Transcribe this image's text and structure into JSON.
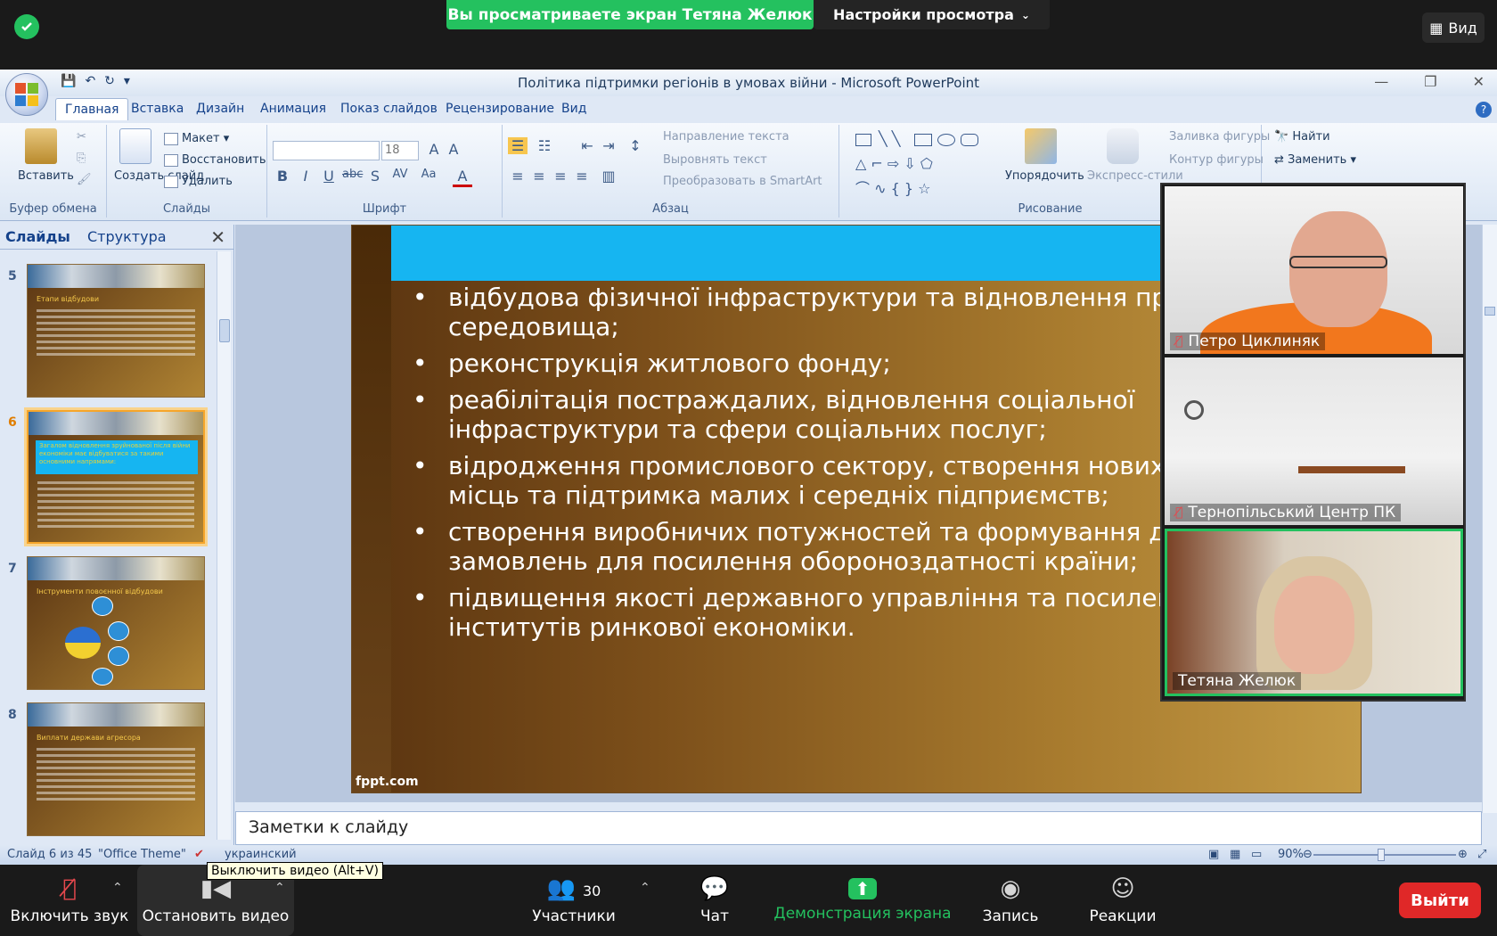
{
  "zoom_top": {
    "viewing_banner": "Вы просматриваете экран Тетяна Желюк",
    "view_settings": "Настройки просмотра",
    "view_button": "Вид"
  },
  "ppt": {
    "window_title": "Політика підтримки регіонів в умовах війни - Microsoft PowerPoint",
    "tabs": [
      "Главная",
      "Вставка",
      "Дизайн",
      "Анимация",
      "Показ слайдов",
      "Рецензирование",
      "Вид"
    ],
    "ribbon": {
      "paste": "Вставить",
      "create_slide": "Создать слайд",
      "layout": "Макет",
      "restore": "Восстановить",
      "delete": "Удалить",
      "font_size": "18",
      "text_direction": "Направление текста",
      "align_text": "Выровнять текст",
      "convert_smartart": "Преобразовать в SmartArt",
      "arrange": "Упорядочить",
      "quick_styles": "Экспресс-стили",
      "shape_fill": "Заливка фигуры",
      "shape_outline": "Контур фигуры",
      "find": "Найти",
      "replace": "Заменить",
      "groups": {
        "clipboard": "Буфер обмена",
        "slides": "Слайды",
        "font": "Шрифт",
        "paragraph": "Абзац",
        "drawing": "Рисование"
      }
    },
    "left_pane": {
      "tab_slides": "Слайды",
      "tab_outline": "Структура",
      "thumbs": [
        {
          "num": "5",
          "title": "Етапи відбудови"
        },
        {
          "num": "6",
          "title": "Загалом відновлення зруйнованої після війни економіки має відбуватися за такими основними напрямами:"
        },
        {
          "num": "7",
          "title": "Інструменти повоєнної відбудови"
        },
        {
          "num": "8",
          "title": "Виплати держави агресора"
        }
      ]
    },
    "slide": {
      "bullets": [
        "відбудова фізичної інфраструктури та відновлення при\nсередовища;",
        "реконструкція житлового фонду;",
        "реабілітація постраждалих, відновлення соціальної\nінфраструктури та сфери соціальних послуг;",
        "відродження промислового сектору, створення нових\nмісць та підтримка малих і середніх підприємств;",
        "створення виробничих потужностей та формування де\nзамовлень для посилення обороноздатності країни;",
        "підвищення якості державного управління та посилен\nінститутів ринкової економіки."
      ],
      "footer": "fppt.com"
    },
    "notes_placeholder": "Заметки к слайду",
    "status": {
      "slide_of": "Слайд 6 из 45",
      "theme": "\"Office Theme\"",
      "language": "украинский",
      "zoom": "90%"
    }
  },
  "videos": [
    {
      "name": "Петро Циклиняк",
      "muted": true
    },
    {
      "name": "Тернопільський Центр ПК",
      "muted": true
    },
    {
      "name": "Тетяна Желюк",
      "muted": false
    }
  ],
  "zoom_bar": {
    "tooltip": "Выключить видео (Alt+V)",
    "unmute": "Включить звук",
    "stop_video": "Остановить видео",
    "participants": "Участники",
    "participants_count": "30",
    "chat": "Чат",
    "share_screen": "Демонстрация экрана",
    "record": "Запись",
    "reactions": "Реакции",
    "leave": "Выйти"
  },
  "colors": {
    "zoom_green": "#24c15f",
    "leave_red": "#e02828",
    "slide_blue": "#16b5f1"
  }
}
